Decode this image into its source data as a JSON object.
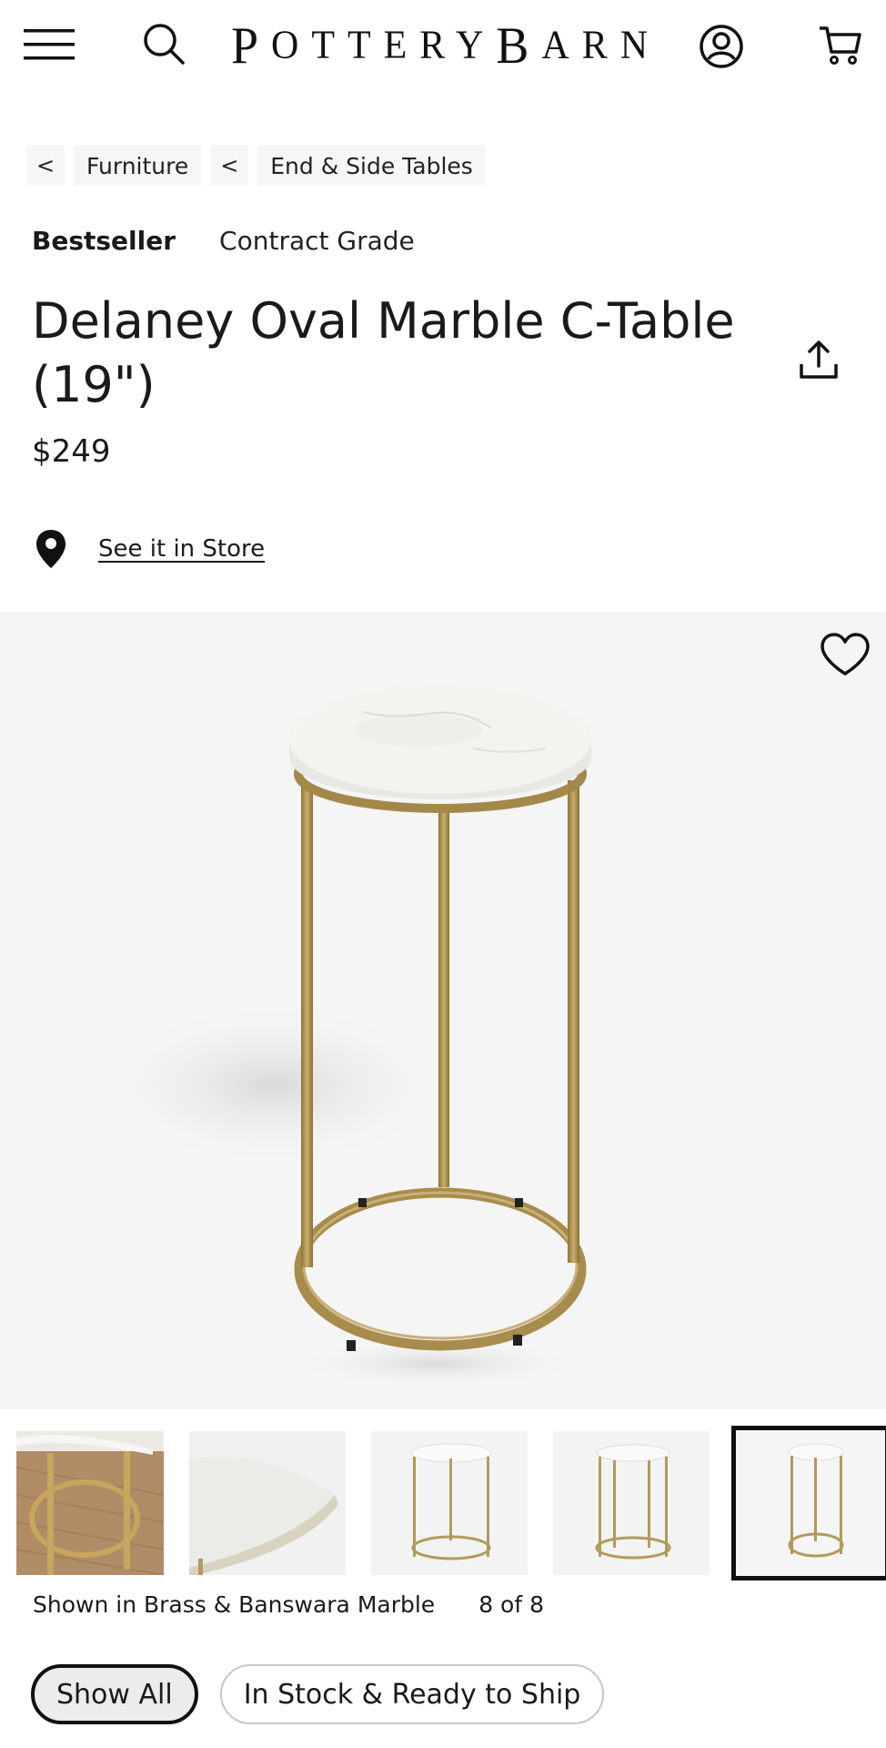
{
  "header": {
    "logo_lead": "P",
    "logo_mid": "OTTERY",
    "logo_b": "B",
    "logo_tail": "ARN",
    "icons": [
      "menu-icon",
      "search-icon",
      "account-icon",
      "cart-icon"
    ]
  },
  "breadcrumb": {
    "back_glyph": "<",
    "items": [
      {
        "label": "Furniture"
      },
      {
        "label": "End & Side Tables"
      }
    ]
  },
  "product": {
    "badge_primary": "Bestseller",
    "badge_secondary": "Contract Grade",
    "title": "Delaney Oval Marble C-Table (19\")",
    "price": "$249",
    "store_link": "See it in Store"
  },
  "gallery": {
    "caption": "Shown in Brass & Banswara Marble",
    "counter": "8 of 8",
    "thumbnail_count": 8,
    "selected_index": 8
  },
  "filters": {
    "show_all": "Show All",
    "in_stock": "In Stock & Ready to Ship"
  },
  "colors": {
    "text": "#1a1a1a",
    "hero_bg": "#f5f5f5",
    "brass": "#b39a5c",
    "marble": "#f2f2f0"
  }
}
